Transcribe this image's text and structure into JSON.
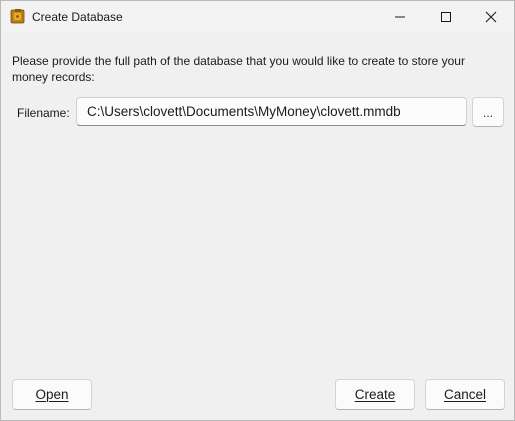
{
  "window": {
    "title": "Create Database",
    "app_icon": "money-box-icon",
    "caption_buttons": [
      "minimize-icon",
      "maximize-icon",
      "close-icon"
    ]
  },
  "prompt": "Please provide the full path of the database that you would like to create to store your money records:",
  "filename": {
    "label": "Filename:",
    "value": "C:\\Users\\clovett\\Documents\\MyMoney\\clovett.mmdb",
    "browse_label": "..."
  },
  "buttons": {
    "open": "Open",
    "create": "Create",
    "cancel": "Cancel"
  }
}
